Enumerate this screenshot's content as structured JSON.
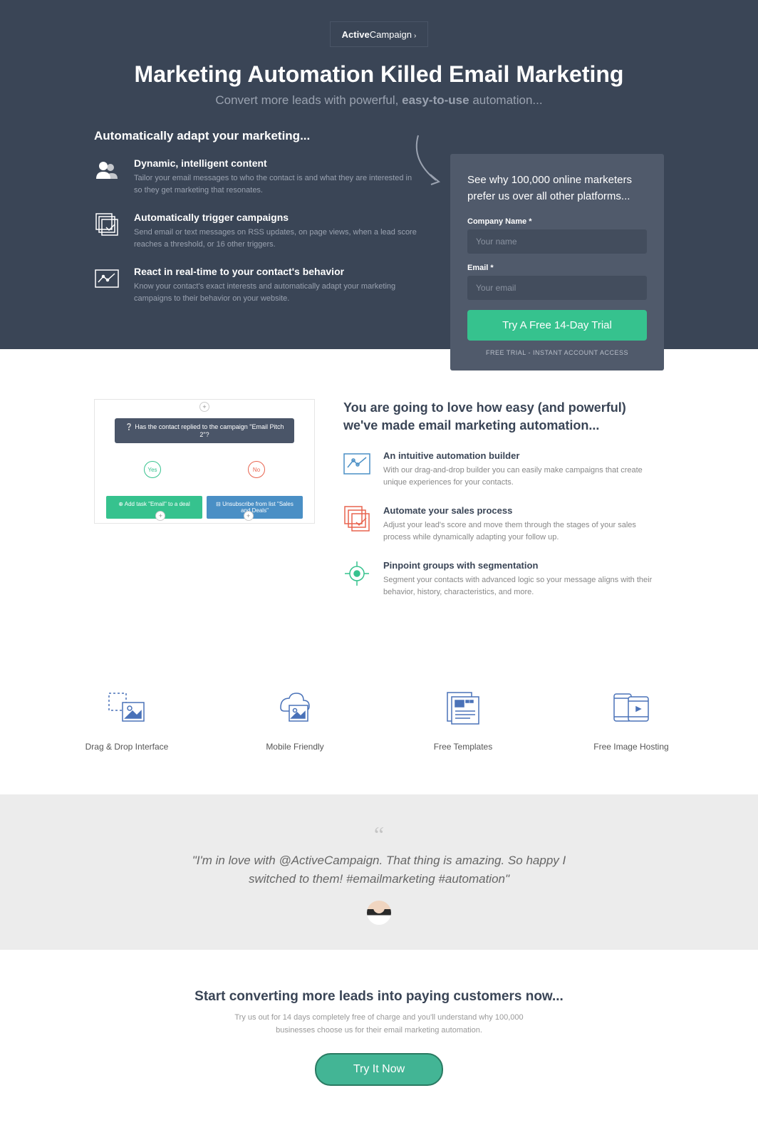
{
  "logo": {
    "brand_a": "Active",
    "brand_b": "Campaign"
  },
  "hero": {
    "headline": "Marketing Automation Killed Email Marketing",
    "sub_a": "Convert more leads with powerful, ",
    "sub_b": "easy-to-use",
    "sub_c": " automation...",
    "section_title": "Automatically adapt your marketing...",
    "features": [
      {
        "title": "Dynamic, intelligent content",
        "desc": "Tailor your email messages to who the contact is and what they are interested in so they get marketing that resonates."
      },
      {
        "title": "Automatically trigger campaigns",
        "desc": "Send email or text messages on RSS updates, on page views, when a lead score reaches a threshold, or 16 other triggers."
      },
      {
        "title": "React in real-time to your contact's behavior",
        "desc": "Know your contact's exact interests and automatically adapt your marketing campaigns to their behavior on your website."
      }
    ]
  },
  "form": {
    "title": "See why 100,000 online marketers prefer us over all other platforms...",
    "company_label": "Company Name *",
    "company_placeholder": "Your name",
    "email_label": "Email *",
    "email_placeholder": "Your email",
    "button": "Try A Free 14-Day Trial",
    "note": "FREE TRIAL - INSTANT ACCOUNT ACCESS"
  },
  "flow": {
    "question": "Has the contact replied to the campaign \"Email Pitch 2\"?",
    "yes": "Yes",
    "no": "No",
    "action_a": "⊕ Add task \"Email\" to a deal",
    "action_b": "⊟ Unsubscribe from list \"Sales and Deals\""
  },
  "love": {
    "title": "You are going to love how easy (and powerful) we've made email marketing automation...",
    "items": [
      {
        "title": "An intuitive automation builder",
        "desc": "With our drag-and-drop builder you can easily make campaigns that create unique experiences for your contacts."
      },
      {
        "title": "Automate your sales process",
        "desc": "Adjust your lead's score and move them through the stages of your sales process while dynamically adapting your follow up."
      },
      {
        "title": "Pinpoint groups with segmentation",
        "desc": "Segment your contacts with advanced logic so your message aligns with their behavior, history, characteristics, and more."
      }
    ]
  },
  "grid": [
    {
      "label": "Drag & Drop Interface"
    },
    {
      "label": "Mobile Friendly"
    },
    {
      "label": "Free Templates"
    },
    {
      "label": "Free Image Hosting"
    }
  ],
  "testimonial": {
    "text": "\"I'm in love with @ActiveCampaign. That thing is amazing. So happy I switched to them! #emailmarketing #automation\""
  },
  "cta": {
    "title": "Start converting more leads into paying customers now...",
    "sub": "Try us out for 14 days completely free of charge and you'll understand why 100,000 businesses choose us for their email marketing automation.",
    "button": "Try It Now"
  }
}
